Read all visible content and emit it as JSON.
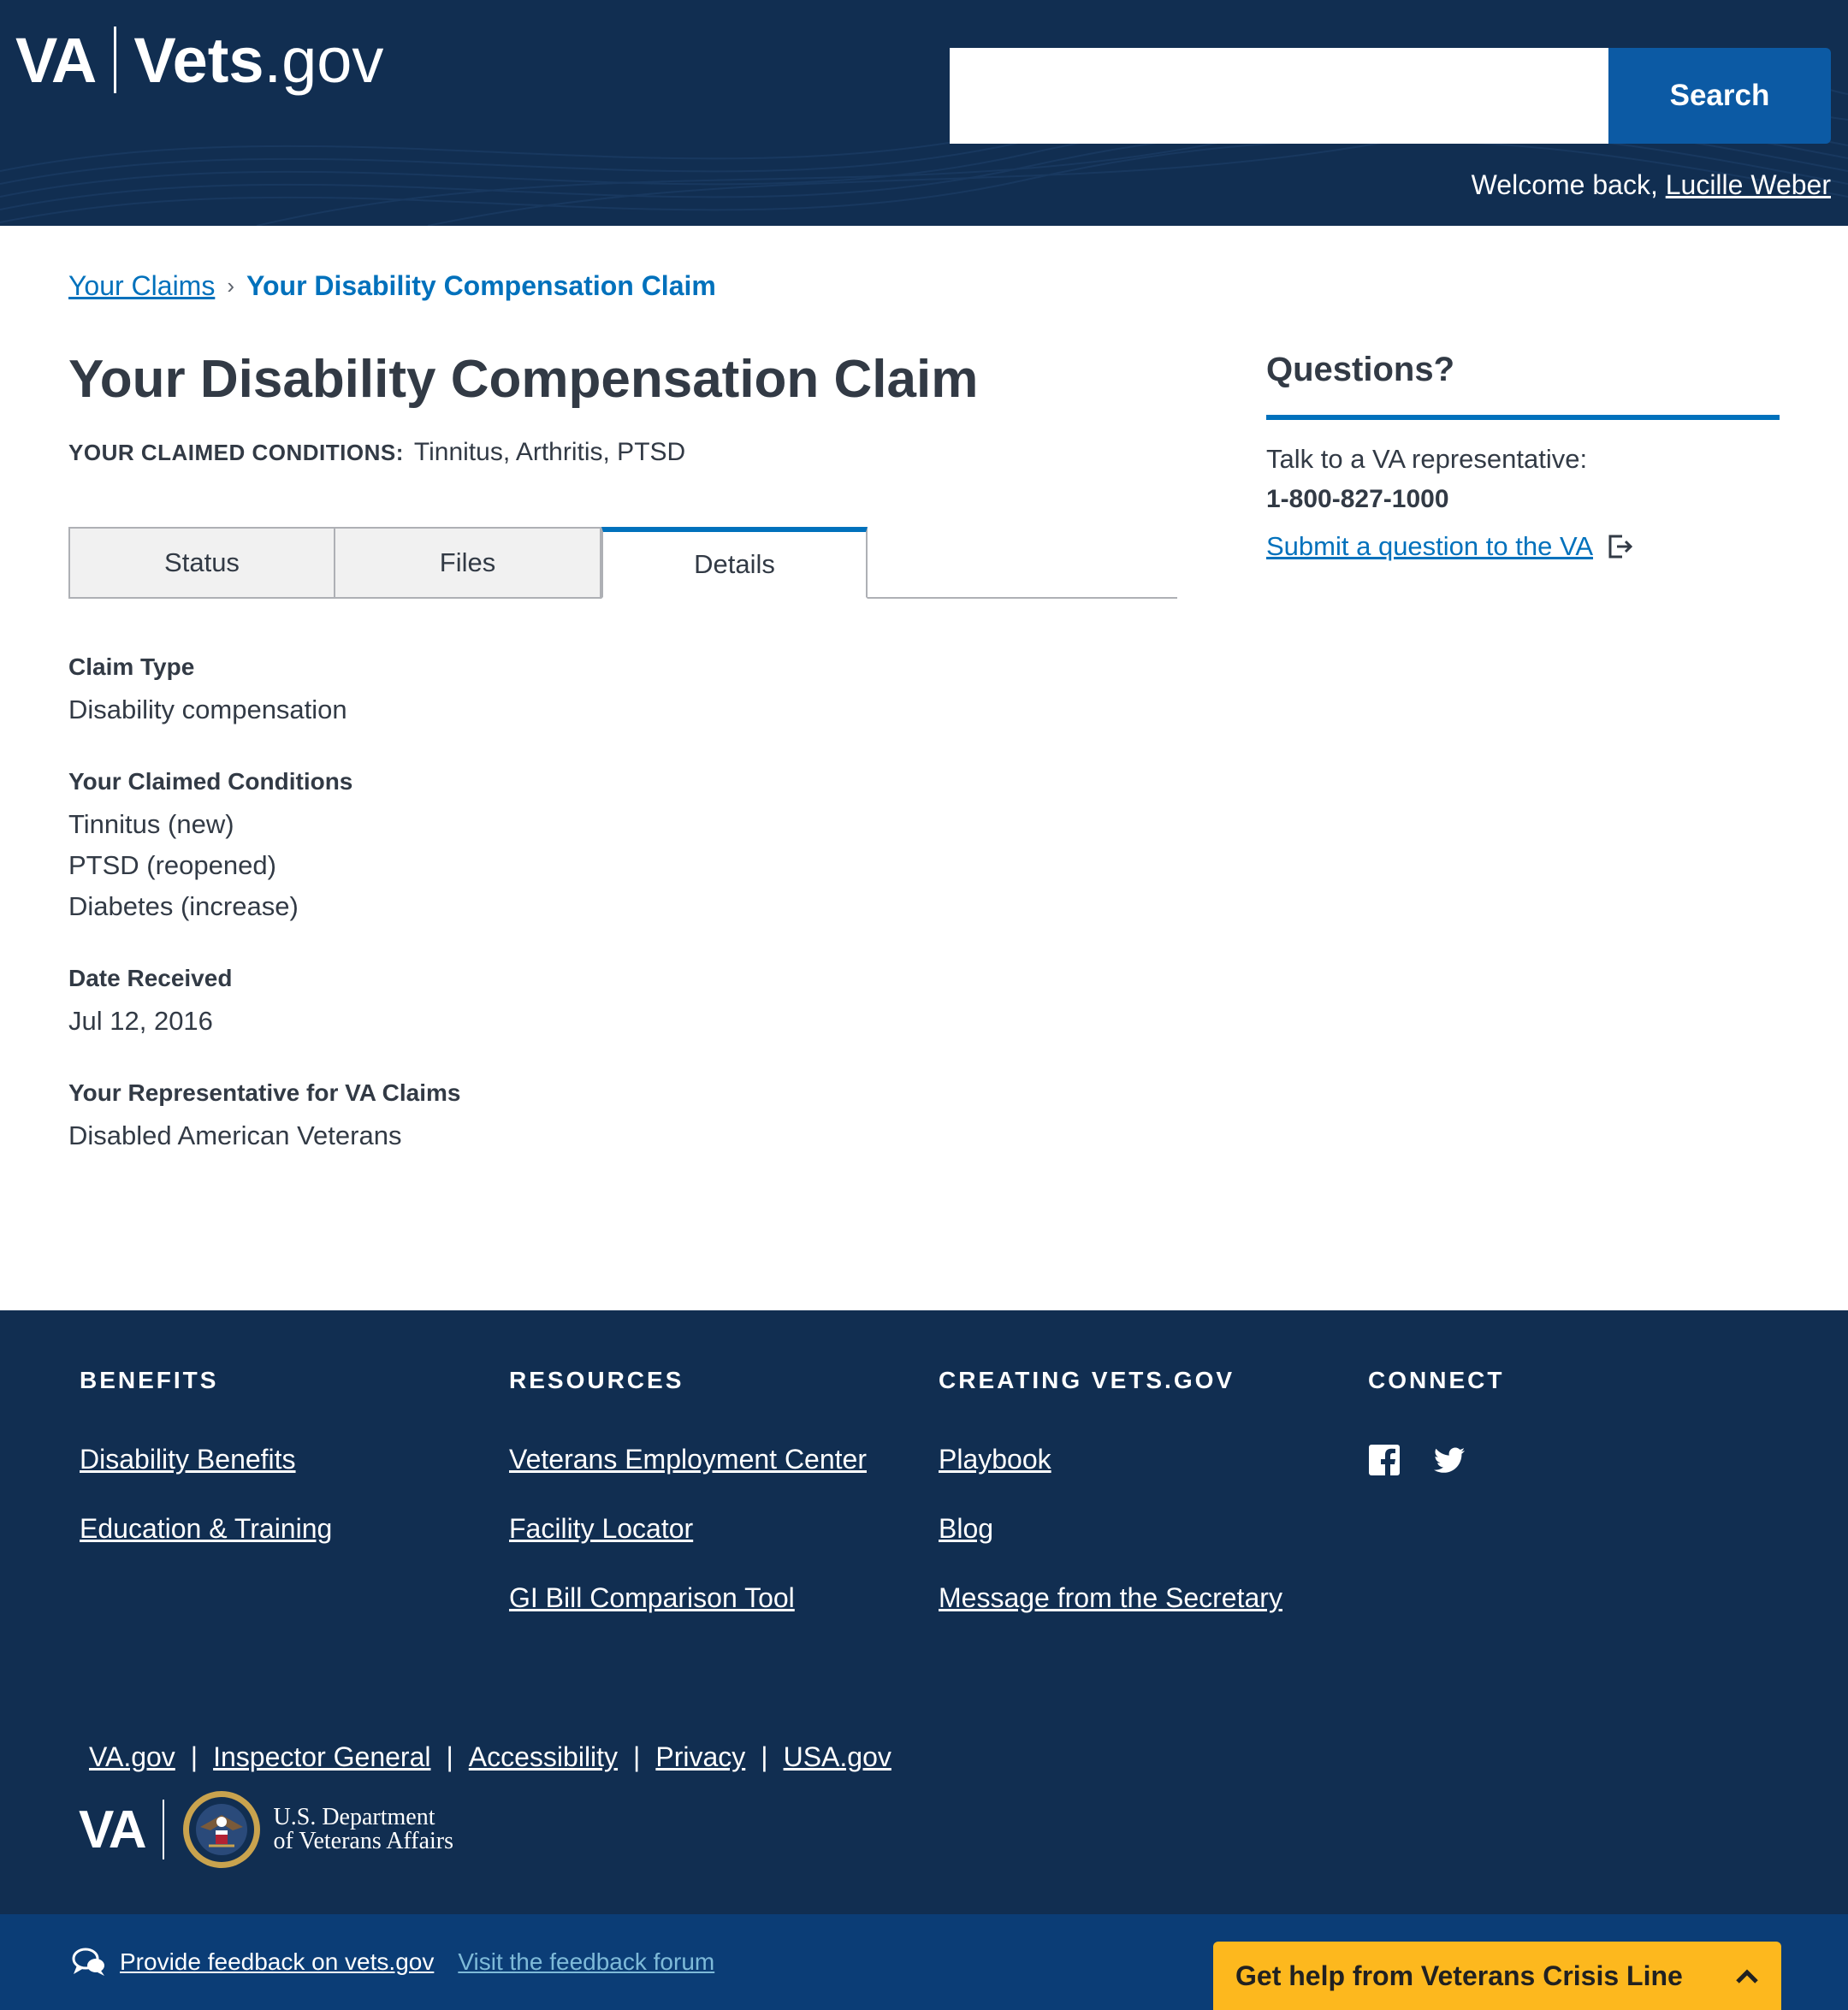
{
  "header": {
    "logo_va": "VA",
    "logo_vets": "Vets",
    "logo_gov": ".gov",
    "search_placeholder": "",
    "search_button": "Search",
    "welcome_prefix": "Welcome back, ",
    "user_name": "Lucille Weber",
    "bg_color": "#112e51"
  },
  "breadcrumb": {
    "items": [
      "Your Claims",
      "Your Disability Compensation Claim"
    ]
  },
  "main": {
    "title": "Your Disability Compensation Claim",
    "conditions_label": "YOUR CLAIMED CONDITIONS:",
    "conditions_value": "Tinnitus, Arthritis, PTSD",
    "tabs": [
      {
        "label": "Status",
        "active": false
      },
      {
        "label": "Files",
        "active": false
      },
      {
        "label": "Details",
        "active": true
      }
    ],
    "details": {
      "claim_type_label": "Claim Type",
      "claim_type_value": "Disability compensation",
      "conditions_label": "Your Claimed Conditions",
      "conditions": [
        "Tinnitus (new)",
        "PTSD (reopened)",
        "Diabetes (increase)"
      ],
      "date_label": "Date Received",
      "date_value": "Jul 12, 2016",
      "rep_label": "Your Representative for VA Claims",
      "rep_value": "Disabled American Veterans"
    }
  },
  "aside": {
    "heading": "Questions?",
    "talk": "Talk to a VA representative:",
    "phone": "1-800-827-1000",
    "submit_link": "Submit a question to the VA"
  },
  "footer": {
    "columns": [
      {
        "heading": "BENEFITS",
        "links": [
          "Disability Benefits",
          "Education & Training"
        ]
      },
      {
        "heading": "RESOURCES",
        "links": [
          "Veterans Employment Center",
          "Facility Locator",
          "GI Bill Comparison Tool"
        ]
      },
      {
        "heading": "CREATING VETS.GOV",
        "links": [
          "Playbook",
          "Blog",
          "Message from the Secretary"
        ]
      },
      {
        "heading": "CONNECT",
        "links": []
      }
    ],
    "legal_links": [
      "VA.gov",
      "Inspector General",
      "Accessibility",
      "Privacy",
      "USA.gov"
    ],
    "brand_va": "VA",
    "dept_line1": "U.S. Department",
    "dept_line2": "of Veterans Affairs"
  },
  "bottom_bar": {
    "feedback_link": "Provide feedback on vets.gov",
    "forum_link": "Visit the feedback forum",
    "crisis_button": "Get help from Veterans Crisis Line",
    "crisis_color": "#fdb81e"
  },
  "icons": {
    "external": "external-link-icon",
    "facebook": "facebook-icon",
    "twitter": "twitter-icon",
    "feedback": "feedback-bubble-icon",
    "chevron": "chevron-up-icon",
    "seal": "va-seal-icon"
  }
}
